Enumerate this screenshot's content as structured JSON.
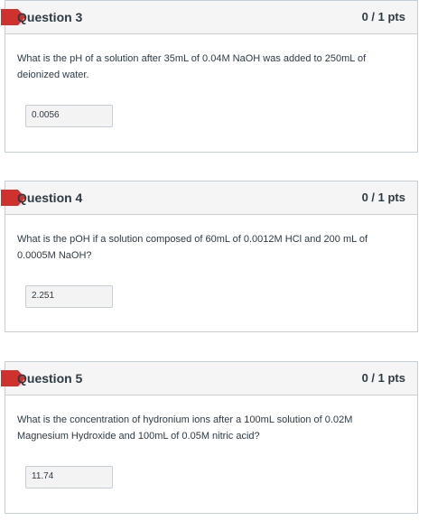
{
  "questions": [
    {
      "title": "Question 3",
      "points": "0 / 1 pts",
      "text": "What is the pH of a solution after 35mL of 0.04M NaOH was added to 250mL of deionized water.",
      "answer": "0.0056"
    },
    {
      "title": "Question 4",
      "points": "0 / 1 pts",
      "text": "What is the pOH if a solution composed of 60mL of  0.0012M HCl and 200 mL of 0.0005M NaOH?",
      "answer": "2.251"
    },
    {
      "title": "Question 5",
      "points": "0 / 1 pts",
      "text": "What is the concentration of hydronium ions after a 100mL solution of 0.02M Magnesium Hydroxide and 100mL of 0.05M nitric acid?",
      "answer": "11.74"
    }
  ],
  "colors": {
    "flag": "#d0312d",
    "header_bg": "#f5f5f5",
    "border": "#c7cdd1",
    "text": "#2d3b45"
  }
}
